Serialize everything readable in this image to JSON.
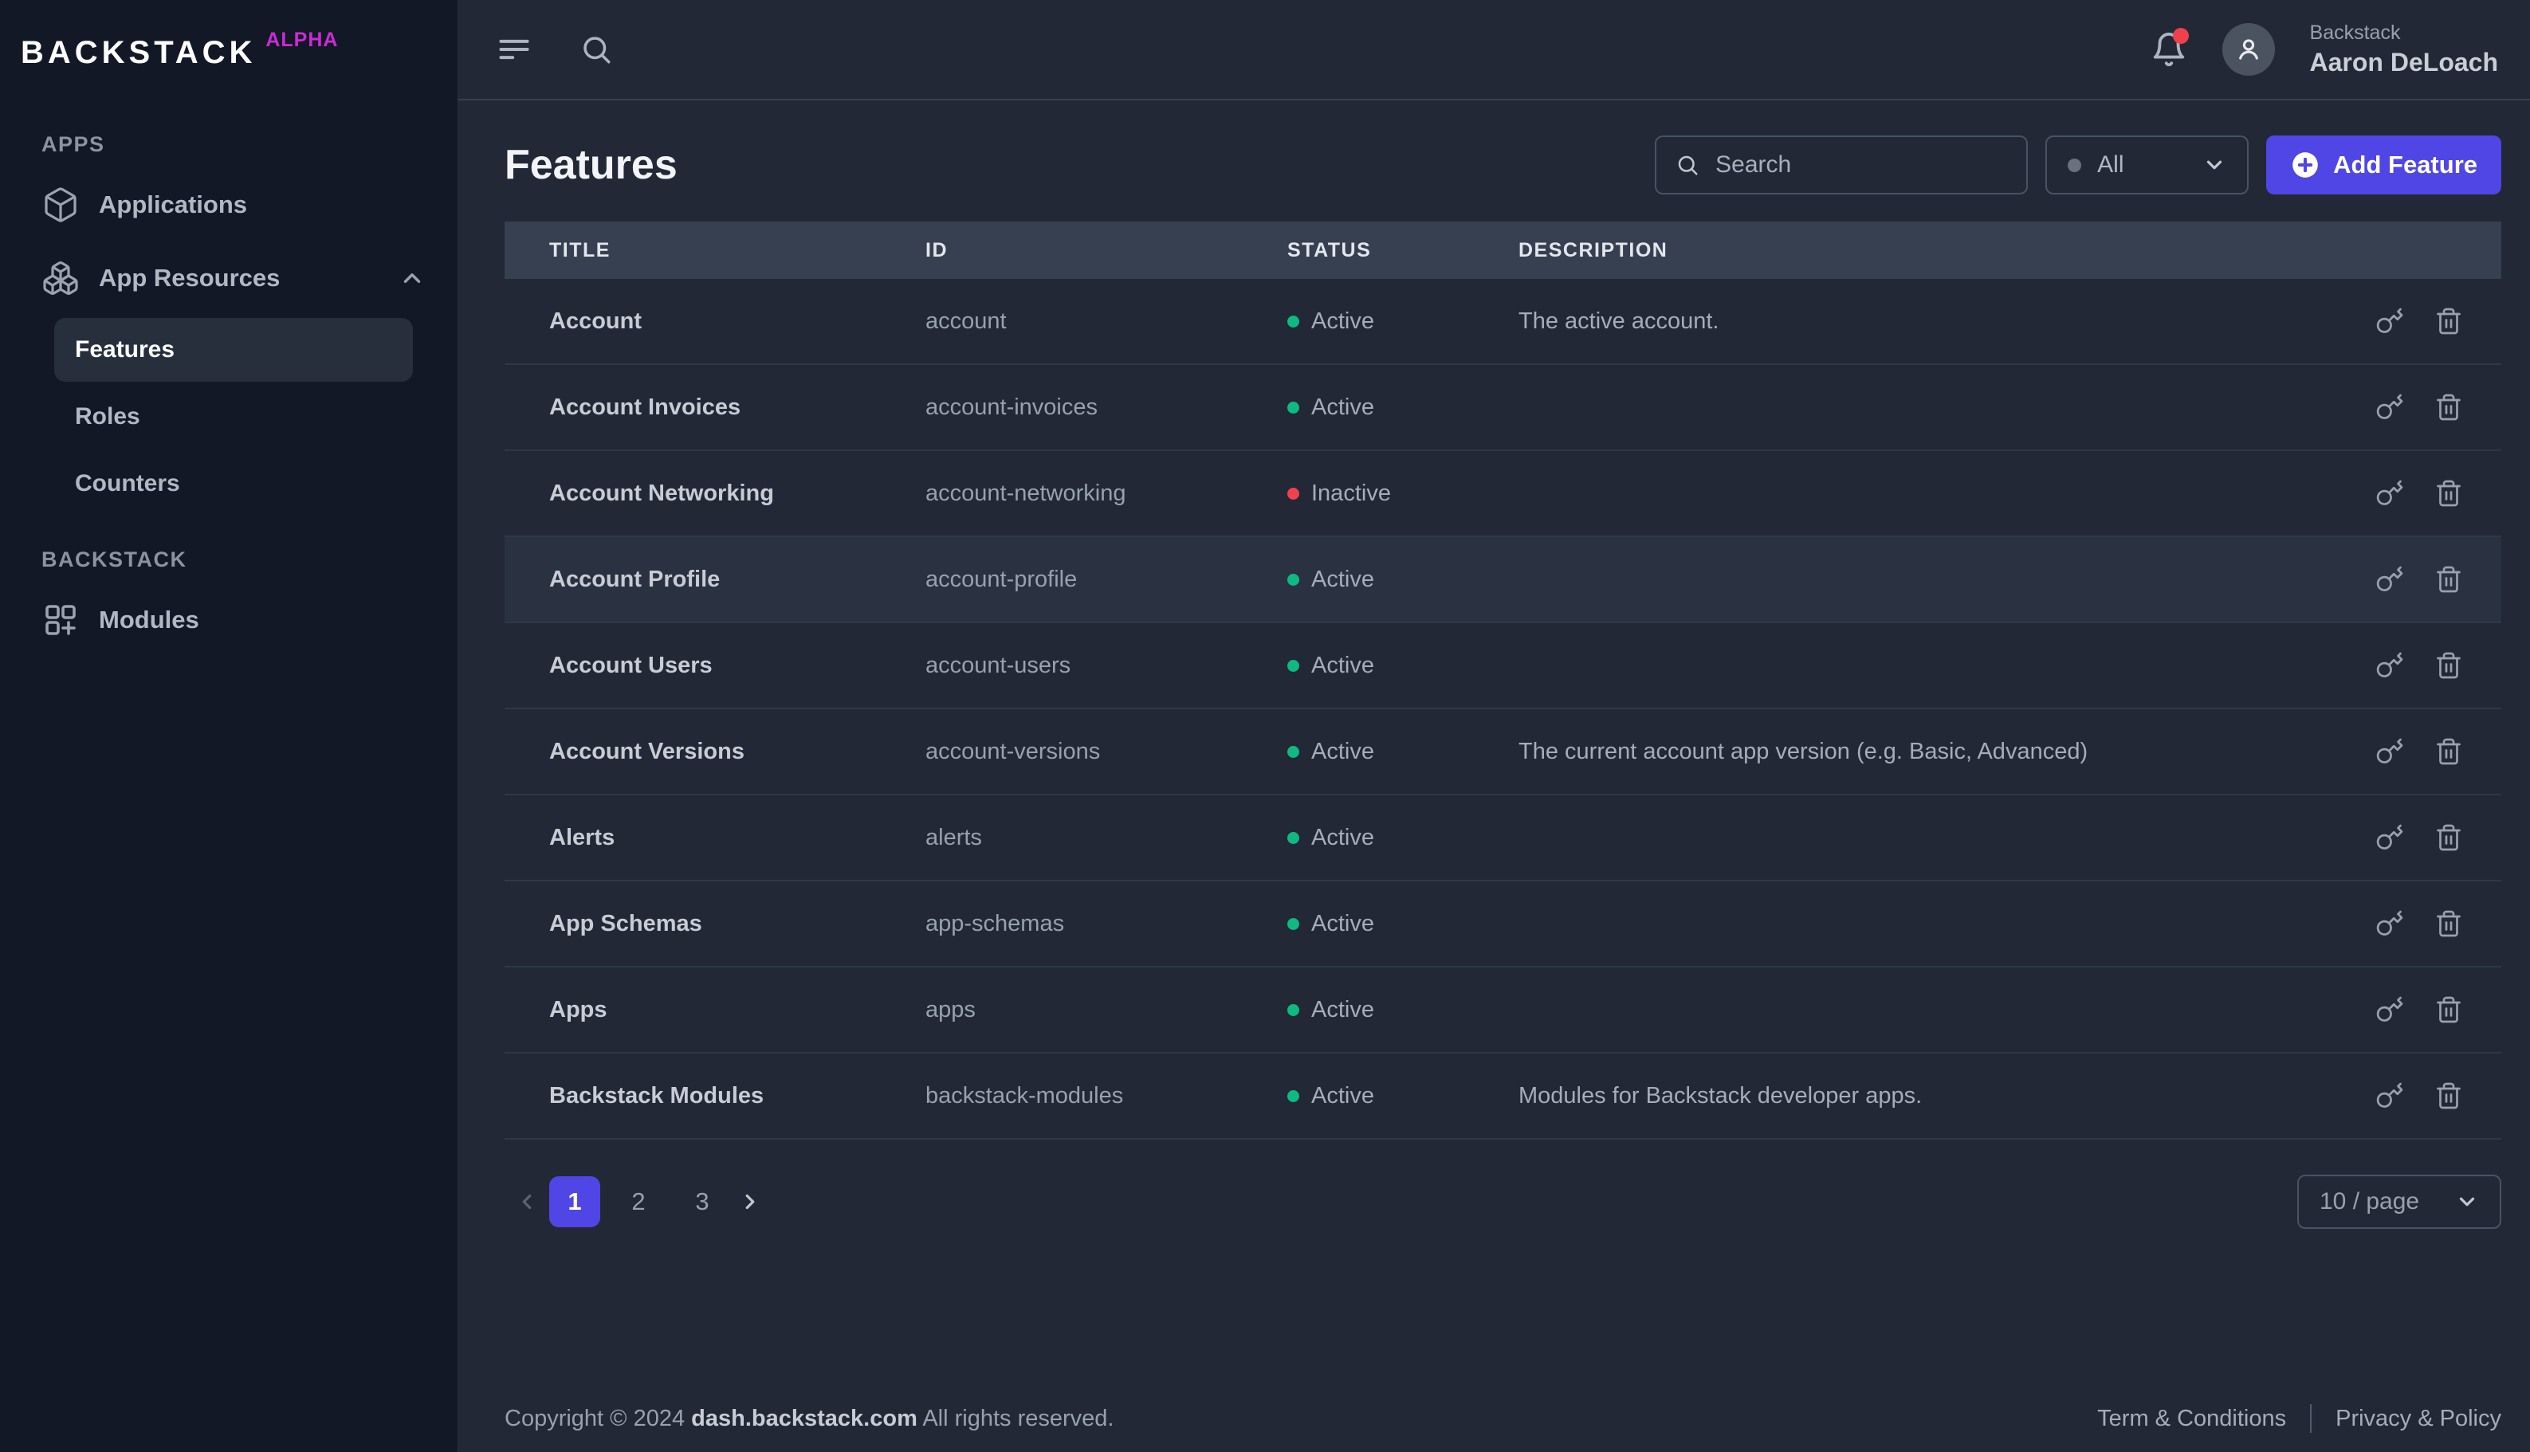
{
  "brand": {
    "name": "BACKSTACK",
    "badge": "ALPHA"
  },
  "topbar": {
    "user": {
      "org": "Backstack",
      "name": "Aaron DeLoach"
    },
    "icons": [
      "menu-icon",
      "search-icon",
      "bell-icon",
      "avatar-user-icon"
    ]
  },
  "sidebar": {
    "sections": [
      {
        "label": "APPS",
        "items": [
          {
            "label": "Applications",
            "icon": "cube-icon"
          },
          {
            "label": "App Resources",
            "icon": "boxes-icon",
            "expanded": true,
            "children": [
              {
                "label": "Features",
                "active": true
              },
              {
                "label": "Roles",
                "active": false
              },
              {
                "label": "Counters",
                "active": false
              }
            ]
          }
        ]
      },
      {
        "label": "BACKSTACK",
        "items": [
          {
            "label": "Modules",
            "icon": "modules-plus-icon"
          }
        ]
      }
    ]
  },
  "page": {
    "title": "Features",
    "search_placeholder": "Search",
    "filter_value": "All",
    "add_button": "Add Feature"
  },
  "table": {
    "columns": [
      "TITLE",
      "ID",
      "STATUS",
      "DESCRIPTION"
    ],
    "rows": [
      {
        "title": "Account",
        "id": "account",
        "status": "Active",
        "description": "The active account.",
        "highlighted": false
      },
      {
        "title": "Account Invoices",
        "id": "account-invoices",
        "status": "Active",
        "description": "",
        "highlighted": false
      },
      {
        "title": "Account Networking",
        "id": "account-networking",
        "status": "Inactive",
        "description": "",
        "highlighted": false
      },
      {
        "title": "Account Profile",
        "id": "account-profile",
        "status": "Active",
        "description": "",
        "highlighted": true
      },
      {
        "title": "Account Users",
        "id": "account-users",
        "status": "Active",
        "description": "",
        "highlighted": false
      },
      {
        "title": "Account Versions",
        "id": "account-versions",
        "status": "Active",
        "description": "The current account app version (e.g. Basic, Advanced)",
        "highlighted": false
      },
      {
        "title": "Alerts",
        "id": "alerts",
        "status": "Active",
        "description": "",
        "highlighted": false
      },
      {
        "title": "App Schemas",
        "id": "app-schemas",
        "status": "Active",
        "description": "",
        "highlighted": false
      },
      {
        "title": "Apps",
        "id": "apps",
        "status": "Active",
        "description": "",
        "highlighted": false
      },
      {
        "title": "Backstack Modules",
        "id": "backstack-modules",
        "status": "Active",
        "description": "Modules for Backstack developer apps.",
        "highlighted": false
      }
    ],
    "row_actions": [
      "key-icon",
      "trash-icon"
    ]
  },
  "pagination": {
    "pages": [
      "1",
      "2",
      "3"
    ],
    "active": "1",
    "page_size": "10 / page"
  },
  "footer": {
    "prefix": "Copyright © 2024",
    "domain": "dash.backstack.com",
    "suffix": "All rights reserved.",
    "links": [
      "Term & Conditions",
      "Privacy & Policy"
    ]
  },
  "colors": {
    "accent_indigo": "#4f46e5",
    "status_active": "#10b981",
    "status_inactive": "#f0414d",
    "alpha_badge": "#cb2bd6",
    "sidebar_bg": "#131826",
    "main_bg": "#222836",
    "table_header_bg": "#374050",
    "notification_dot": "#f0404c"
  }
}
